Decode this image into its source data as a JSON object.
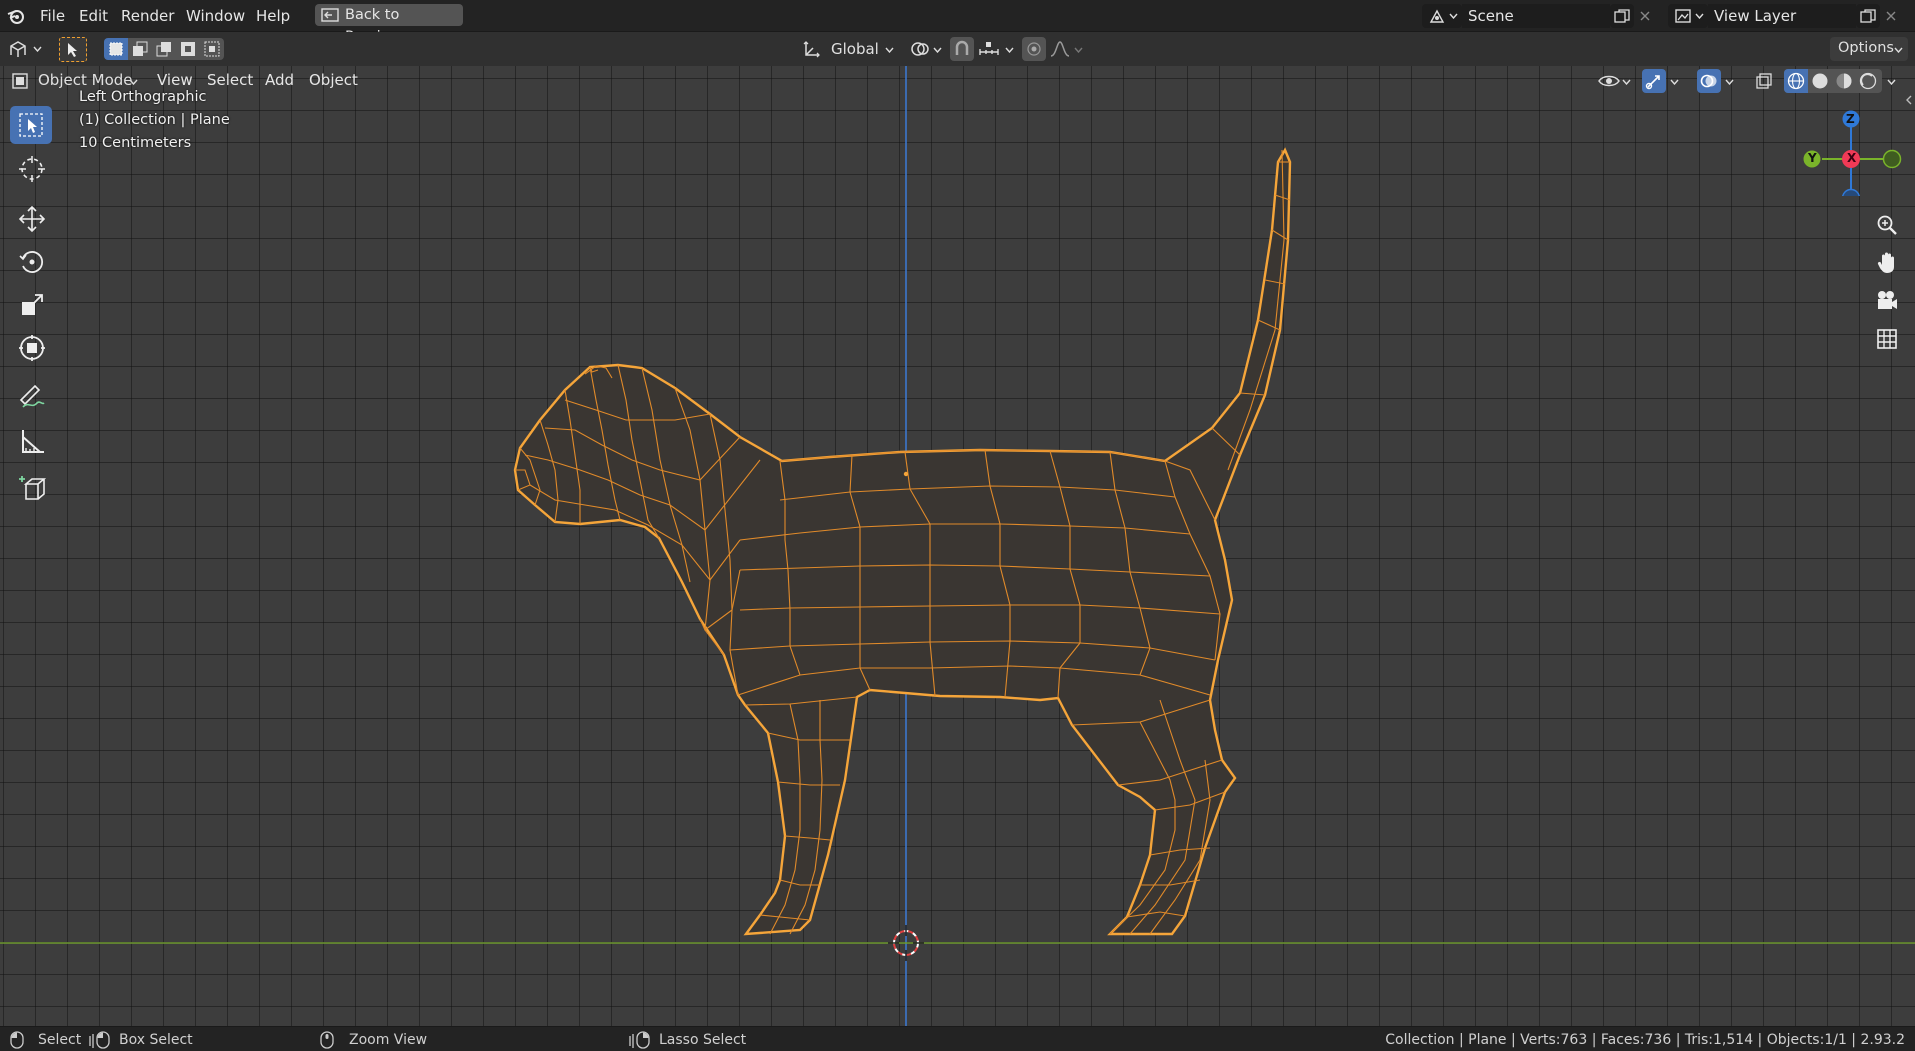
{
  "menubar": {
    "items": [
      "File",
      "Edit",
      "Render",
      "Window",
      "Help"
    ],
    "back_button": "Back to Previous",
    "scene_name": "Scene",
    "view_layer_name": "View Layer"
  },
  "tool_header": {
    "orientation": "Global",
    "options_label": "Options"
  },
  "viewport_header": {
    "mode": "Object Mode",
    "menus": [
      "View",
      "Select",
      "Add",
      "Object"
    ]
  },
  "viewport_overlay": {
    "view_name": "Left Orthographic",
    "collection_info": "(1) Collection | Plane",
    "scale_info": "10 Centimeters"
  },
  "gizmo": {
    "z_label": "Z",
    "y_label": "Y",
    "x_label": "X"
  },
  "statusbar": {
    "select": "Select",
    "box_select": "Box Select",
    "zoom_view": "Zoom View",
    "lasso_select": "Lasso Select",
    "stats": "Collection | Plane | Verts:763 | Faces:736 | Tris:1,514 | Objects:1/1 | 2.93.2"
  },
  "colors": {
    "accent": "#4772b3",
    "selection_outline": "#f5a53a",
    "wire": "#e08a2a",
    "axis_y_line": "#6f9a30",
    "axis_z_line": "#3d7bd6",
    "gizmo_x": "#f03a56",
    "gizmo_y": "#7ab42a",
    "gizmo_z": "#2f79d8"
  }
}
